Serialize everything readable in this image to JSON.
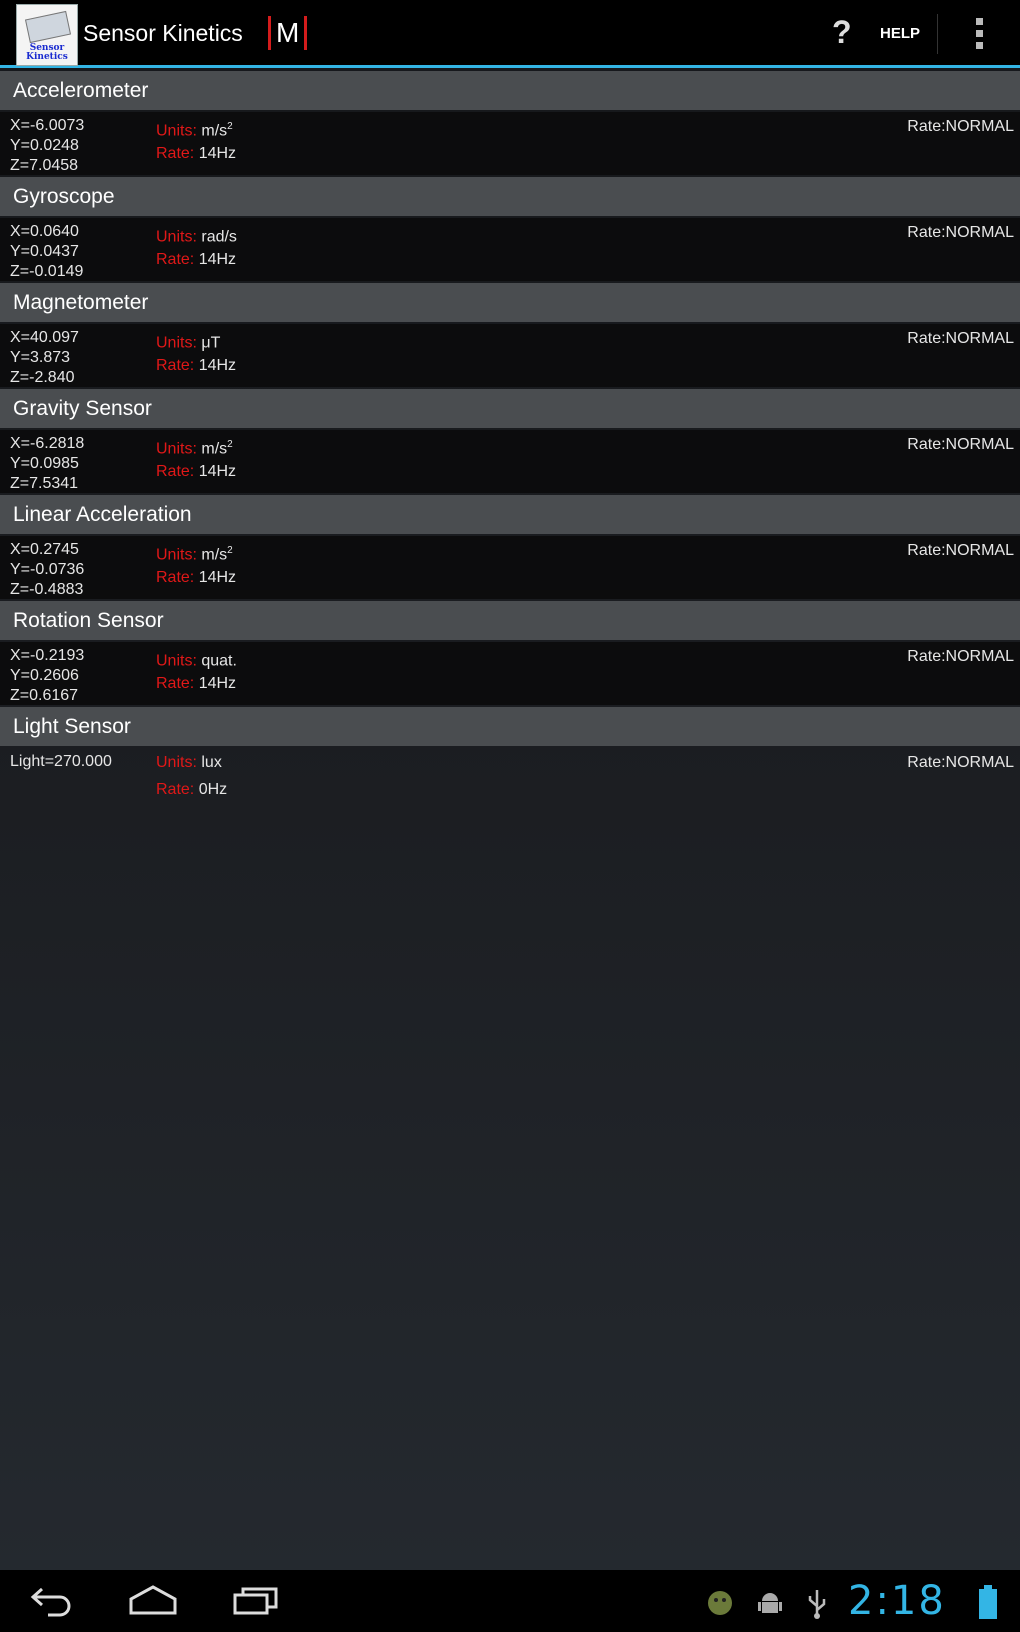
{
  "app": {
    "icon_caption": "Sensor Kinetics",
    "title": "Sensor Kinetics",
    "badge": "M",
    "help_glyph": "?",
    "help_label": "HELP",
    "overflow_icon": "overflow-menu-icon"
  },
  "colors": {
    "accent": "#33b5e5",
    "label_red": "#e01818",
    "header_bg": "#4a4d50"
  },
  "labels": {
    "units": "Units:",
    "rate": "Rate:"
  },
  "sensors": [
    {
      "name": "Accelerometer",
      "values": [
        "X=-6.0073",
        "Y=0.0248",
        "Z=7.0458"
      ],
      "unit": "m/s",
      "unit_sup": "2",
      "hz": "14Hz",
      "rate": "Rate:NORMAL"
    },
    {
      "name": "Gyroscope",
      "values": [
        "X=0.0640",
        "Y=0.0437",
        "Z=-0.0149"
      ],
      "unit": "rad/s",
      "unit_sup": "",
      "hz": "14Hz",
      "rate": "Rate:NORMAL"
    },
    {
      "name": "Magnetometer",
      "values": [
        "X=40.097",
        "Y=3.873",
        "Z=-2.840"
      ],
      "unit": "μT",
      "unit_sup": "",
      "hz": "14Hz",
      "rate": "Rate:NORMAL"
    },
    {
      "name": "Gravity Sensor",
      "values": [
        "X=-6.2818",
        "Y=0.0985",
        "Z=7.5341"
      ],
      "unit": "m/s",
      "unit_sup": "2",
      "hz": "14Hz",
      "rate": "Rate:NORMAL"
    },
    {
      "name": "Linear Acceleration",
      "values": [
        "X=0.2745",
        "Y=-0.0736",
        "Z=-0.4883"
      ],
      "unit": "m/s",
      "unit_sup": "2",
      "hz": "14Hz",
      "rate": "Rate:NORMAL"
    },
    {
      "name": "Rotation Sensor",
      "values": [
        "X=-0.2193",
        "Y=0.2606",
        "Z=0.6167"
      ],
      "unit": "quat.",
      "unit_sup": "",
      "hz": "14Hz",
      "rate": "Rate:NORMAL"
    },
    {
      "name": "Light Sensor",
      "values": [
        "Light=270.000"
      ],
      "unit": "lux",
      "unit_sup": "",
      "hz": "0Hz",
      "rate": "Rate:NORMAL"
    }
  ],
  "navbar": {
    "back_icon": "back-icon",
    "home_icon": "home-icon",
    "recents_icon": "recents-icon",
    "clock": "2:18"
  }
}
